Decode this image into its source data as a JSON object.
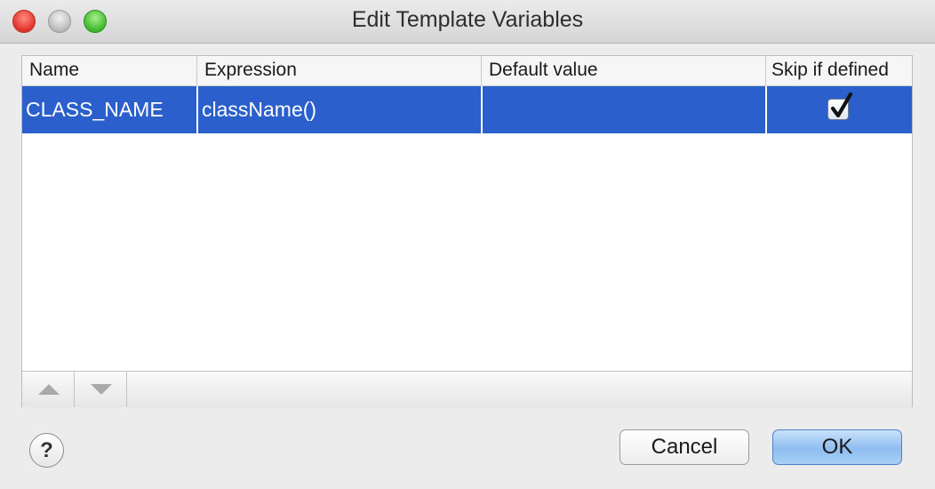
{
  "window": {
    "title": "Edit Template Variables"
  },
  "table": {
    "columns": [
      "Name",
      "Expression",
      "Default value",
      "Skip if defined"
    ],
    "rows": [
      {
        "name": "CLASS_NAME",
        "expression": "className()",
        "default_value": "",
        "skip_if_defined": true,
        "selected": true
      }
    ]
  },
  "toolbar": {
    "move_up_icon": "triangle-up-icon",
    "move_down_icon": "triangle-down-icon"
  },
  "buttons": {
    "help_label": "?",
    "cancel_label": "Cancel",
    "ok_label": "OK"
  },
  "colors": {
    "selection": "#2a5fcc",
    "default_button": "#8fbdf0",
    "close": "#e0322a",
    "minimize": "#b6b6b6",
    "zoom": "#3fb72c"
  }
}
